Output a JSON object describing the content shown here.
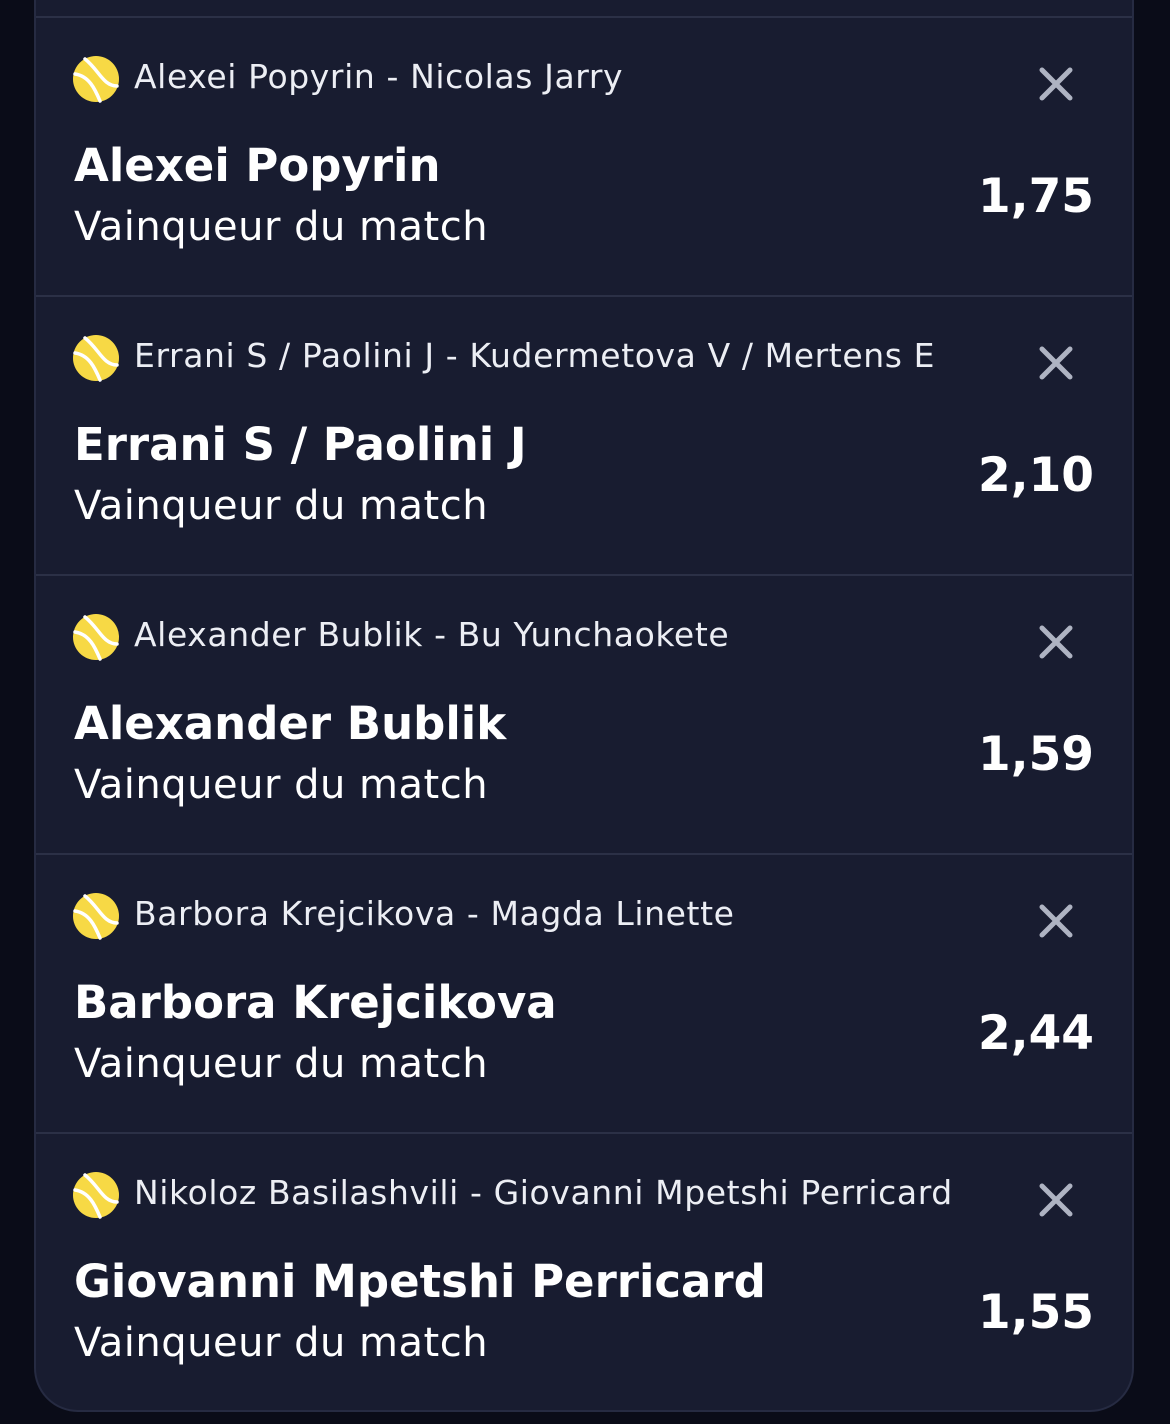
{
  "colors": {
    "background": "#0a0c18",
    "card": "#181c30",
    "divider": "#2b3046",
    "ball": "#f7d945",
    "text": "#ffffff",
    "close": "#aeb3c2"
  },
  "icons": {
    "sport": "tennis-ball-icon",
    "remove": "close-icon"
  },
  "bets": [
    {
      "event": "Alexei Popyrin - Nicolas Jarry",
      "selection": "Alexei Popyrin",
      "market": "Vainqueur du match",
      "odds": "1,75"
    },
    {
      "event": "Errani S / Paolini J - Kudermetova V / Mertens E",
      "selection": "Errani S / Paolini J",
      "market": "Vainqueur du match",
      "odds": "2,10"
    },
    {
      "event": "Alexander Bublik - Bu Yunchaokete",
      "selection": "Alexander Bublik",
      "market": "Vainqueur du match",
      "odds": "1,59"
    },
    {
      "event": "Barbora Krejcikova - Magda Linette",
      "selection": "Barbora Krejcikova",
      "market": "Vainqueur du match",
      "odds": "2,44"
    },
    {
      "event": "Nikoloz Basilashvili - Giovanni Mpetshi Perricard",
      "selection": "Giovanni Mpetshi Perricard",
      "market": "Vainqueur du match",
      "odds": "1,55"
    }
  ]
}
